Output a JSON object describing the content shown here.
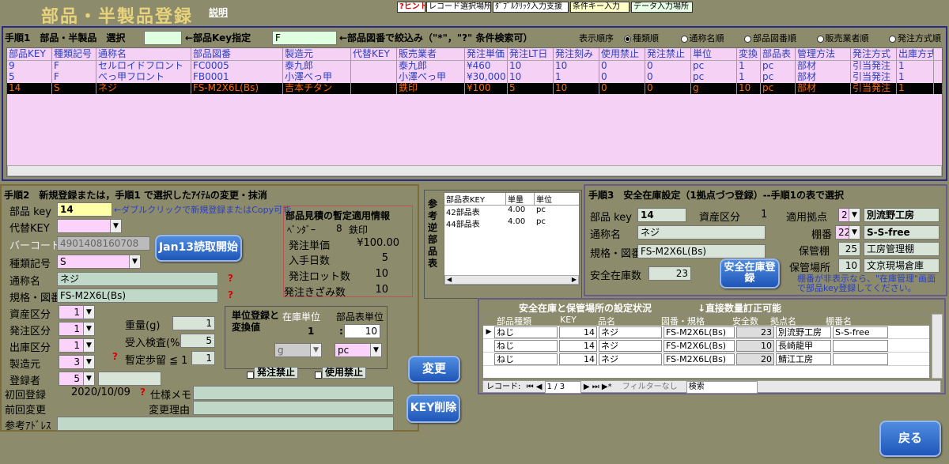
{
  "header": {
    "title": "部品・半製品登録",
    "help": "説明"
  },
  "toolbar": [
    "?ヒント",
    "レコード選択場所",
    "ﾀﾞﾌﾞﾙｸﾘｯｸ入力支援",
    "条件キー入力",
    "データ入力場所"
  ],
  "step1": {
    "title": "手順1　部品・半製品　選択",
    "key_label": "←部品Key指定",
    "key_value": "",
    "filter_value": "F",
    "filter_label": "←部品図番で絞込み（\"*\"，\"?\" 条件検索可）",
    "sort_label": "表示順序",
    "sorts": [
      "種類順",
      "通称名順",
      "部品図番順",
      "販売業者順",
      "発注方式順"
    ],
    "columns": [
      "部品KEY",
      "種類記号",
      "通称名",
      "部品図番",
      "製造元",
      "代替KEY",
      "販売業者",
      "発注単価",
      "発注LT日",
      "発注刻み",
      "使用禁止",
      "発注禁止",
      "単位",
      "変換",
      "部品表",
      "管理方法",
      "発注方式",
      "出庫方式"
    ],
    "rows": [
      [
        "9",
        "F",
        "セルロイドフロント",
        "FC0005",
        "泰九郎",
        "",
        "泰九郎",
        "¥460",
        "10",
        "10",
        "0",
        "0",
        "pc",
        "1",
        "pc",
        "部材",
        "引当発注",
        "1"
      ],
      [
        "5",
        "F",
        "べっ甲フロント",
        "FB0001",
        "小澤べっ甲",
        "",
        "小澤べっ甲",
        "¥30,000",
        "10",
        "1",
        "0",
        "0",
        "pc",
        "1",
        "pc",
        "部材",
        "引当発注",
        "1"
      ],
      [
        "14",
        "S",
        "ネジ",
        "FS-M2X6L(Bs)",
        "吉本チタン",
        "",
        "鉄印",
        "¥100",
        "5",
        "10",
        "0",
        "0",
        "g",
        "10",
        "pc",
        "部材",
        "引当発注",
        "1"
      ]
    ]
  },
  "step2": {
    "title": "手順2　新規登録または，手順1 で選択したｱｲﾃﾑの変更・抹消",
    "key_label": "部品 key",
    "key_value": "14",
    "key_hint": "←ダブルクリックで新規登録またはCopy可能",
    "alt_label": "代替KEY",
    "barcode_label": "バーコード",
    "barcode_value": "4901408160708",
    "jan_btn": "Jan13読取開始",
    "type_label": "種類記号",
    "type_value": "S",
    "name_label": "通称名",
    "name_value": "ネジ",
    "spec_label": "規格・図番",
    "spec_value": "FS-M2X6L(Bs)",
    "asset_label": "資産区分",
    "asset_value": "1",
    "order_label": "発注区分",
    "order_value": "1",
    "ship_label": "出庫区分",
    "ship_value": "1",
    "maker_label": "製造元",
    "maker_value": "3",
    "reg_label": "登録者",
    "reg_value": "5",
    "weight_label": "重量(g)",
    "weight_value": "1",
    "inspect_label": "受入検査(%)",
    "inspect_value": "5",
    "yield_label": "暫定歩留 ≦ 1",
    "yield_value": "1",
    "unit_title": "単位登録と変換値",
    "stock_unit_label": "在庫単位",
    "bom_unit_label": "部品表単位",
    "stock_qty": "1",
    "colon": ":",
    "bom_qty": "10",
    "stock_unit": "g",
    "bom_unit": "pc",
    "order_ban": "発注禁止",
    "use_ban": "使用禁止",
    "change_btn": "変更",
    "delete_btn": "KEY削除",
    "first_label": "初回登録",
    "first_value": "2020/10/09",
    "memo_label": "仕様メモ",
    "prev_label": "前回変更",
    "reason_label": "変更理由",
    "addr_label": "参考ｱﾄﾞﾚｽ"
  },
  "estimate": {
    "title": "部品見積の暫定適用情報",
    "vendor_label": "ﾍﾞﾝﾀﾞｰ",
    "vendor_no": "8",
    "vendor_name": "鉄印",
    "rows": [
      [
        "発注単価",
        "¥100.00"
      ],
      [
        "入手日数",
        "5"
      ],
      [
        "発注ロット数",
        "10"
      ],
      [
        "発注きざみ数",
        "10"
      ]
    ]
  },
  "bomref": {
    "title": "参考逆部品表",
    "columns": [
      "部品表KEY",
      "単量",
      "単位"
    ],
    "rows": [
      [
        "42部品表",
        "4.00",
        "pc"
      ],
      [
        "44部品表",
        "4.00",
        "pc"
      ]
    ]
  },
  "step3": {
    "title": "手順3　安全在庫設定（1拠点づつ登録）--手順1の表で選択",
    "key_label": "部品 key",
    "key_value": "14",
    "asset_label": "資産区分",
    "asset_value": "1",
    "name_label": "通称名",
    "name_value": "ネジ",
    "spec_label": "規格・図番",
    "spec_value": "FS-M2X6L(Bs)",
    "base_label": "適用拠点",
    "base_no": "2",
    "base_name": "別流野工房",
    "shelf_label": "棚番",
    "shelf_no": "22",
    "shelf_name": "S-S-free",
    "store_label": "保管棚",
    "store_no": "25",
    "store_name": "工房管理棚",
    "place_label": "保管場所",
    "place_no": "10",
    "place_name": "文京現場倉庫",
    "safety_label": "安全在庫数",
    "safety_value": "23",
    "reg_btn": "安全在庫登録",
    "note": "棚番が非表示なら、\"在庫管理\"画面で部品key登録してください。"
  },
  "status": {
    "title": "安全在庫と保管場所の設定状況",
    "hint": "↓直接数量訂正可能",
    "columns": [
      "部品種類",
      "KEY",
      "品名",
      "図番・規格",
      "安全数",
      "拠点名",
      "棚番名"
    ],
    "rows": [
      [
        "ねじ",
        "14",
        "ネジ",
        "FS-M2X6L(Bs)",
        "23",
        "別流野工房",
        "S-S-free"
      ],
      [
        "ねじ",
        "14",
        "ネジ",
        "FS-M2X6L(Bs)",
        "10",
        "長崎龍甲",
        ""
      ],
      [
        "ねじ",
        "14",
        "ネジ",
        "FS-M2X6L(Bs)",
        "20",
        "鯖江工房",
        ""
      ]
    ],
    "nav_label": "レコード:",
    "nav_pos": "1 / 3",
    "filter": "フィルターなし",
    "search": "検索"
  },
  "back_btn": "戻る"
}
